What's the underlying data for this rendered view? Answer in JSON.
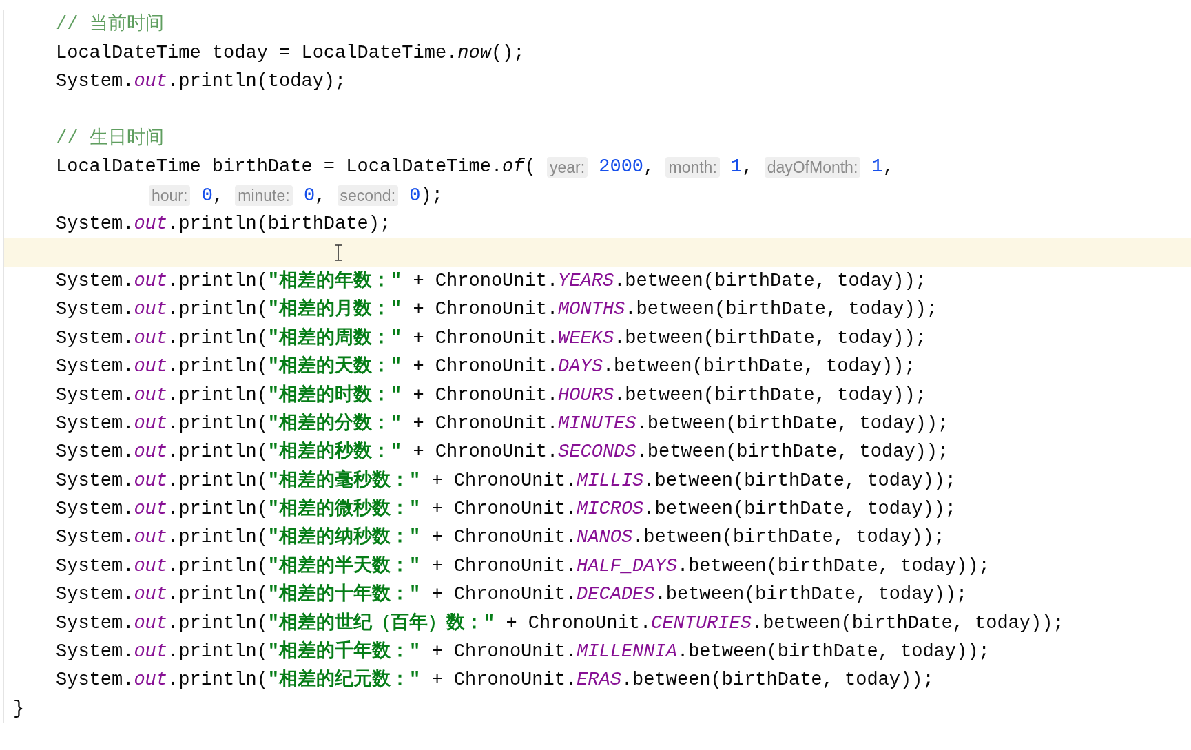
{
  "editor": {
    "lines": [
      {
        "kind": "code",
        "current": false,
        "tokens": [
          {
            "kind": "comment",
            "text": "// 当前时间"
          }
        ]
      },
      {
        "kind": "code",
        "current": false,
        "tokens": [
          {
            "kind": "plain",
            "text": "LocalDateTime today = LocalDateTime."
          },
          {
            "kind": "static_call",
            "text": "now"
          },
          {
            "kind": "plain",
            "text": "();"
          }
        ]
      },
      {
        "kind": "code",
        "current": false,
        "tokens": [
          {
            "kind": "plain",
            "text": "System."
          },
          {
            "kind": "field",
            "text": "out"
          },
          {
            "kind": "plain",
            "text": ".println(today);"
          }
        ]
      },
      {
        "kind": "blank",
        "current": false
      },
      {
        "kind": "code",
        "current": false,
        "tokens": [
          {
            "kind": "comment",
            "text": "// 生日时间"
          }
        ]
      },
      {
        "kind": "code",
        "current": false,
        "tokens": [
          {
            "kind": "plain",
            "text": "LocalDateTime birthDate = LocalDateTime."
          },
          {
            "kind": "static_call",
            "text": "of"
          },
          {
            "kind": "plain",
            "text": "( "
          },
          {
            "kind": "hint",
            "text": "year:"
          },
          {
            "kind": "number",
            "text": " 2000"
          },
          {
            "kind": "plain",
            "text": ", "
          },
          {
            "kind": "hint",
            "text": "month:"
          },
          {
            "kind": "number",
            "text": " 1"
          },
          {
            "kind": "plain",
            "text": ", "
          },
          {
            "kind": "hint",
            "text": "dayOfMonth:"
          },
          {
            "kind": "number",
            "text": " 1"
          },
          {
            "kind": "plain",
            "text": ","
          }
        ]
      },
      {
        "kind": "continuation",
        "current": false,
        "tokens": [
          {
            "kind": "hint",
            "text": "hour:"
          },
          {
            "kind": "number",
            "text": " 0"
          },
          {
            "kind": "plain",
            "text": ", "
          },
          {
            "kind": "hint",
            "text": "minute:"
          },
          {
            "kind": "number",
            "text": " 0"
          },
          {
            "kind": "plain",
            "text": ", "
          },
          {
            "kind": "hint",
            "text": "second:"
          },
          {
            "kind": "number",
            "text": " 0"
          },
          {
            "kind": "plain",
            "text": ");"
          }
        ]
      },
      {
        "kind": "code",
        "current": false,
        "tokens": [
          {
            "kind": "plain",
            "text": "System."
          },
          {
            "kind": "field",
            "text": "out"
          },
          {
            "kind": "plain",
            "text": ".println(birthDate);"
          }
        ]
      },
      {
        "kind": "blank",
        "current": true
      },
      {
        "kind": "code",
        "current": false,
        "tokens": [
          {
            "kind": "plain",
            "text": "System."
          },
          {
            "kind": "field",
            "text": "out"
          },
          {
            "kind": "plain",
            "text": ".println("
          },
          {
            "kind": "string",
            "text": "\"相差的年数：\""
          },
          {
            "kind": "plain",
            "text": " + ChronoUnit."
          },
          {
            "kind": "field",
            "text": "YEARS"
          },
          {
            "kind": "plain",
            "text": ".between(birthDate, today));"
          }
        ]
      },
      {
        "kind": "code",
        "current": false,
        "tokens": [
          {
            "kind": "plain",
            "text": "System."
          },
          {
            "kind": "field",
            "text": "out"
          },
          {
            "kind": "plain",
            "text": ".println("
          },
          {
            "kind": "string",
            "text": "\"相差的月数：\""
          },
          {
            "kind": "plain",
            "text": " + ChronoUnit."
          },
          {
            "kind": "field",
            "text": "MONTHS"
          },
          {
            "kind": "plain",
            "text": ".between(birthDate, today));"
          }
        ]
      },
      {
        "kind": "code",
        "current": false,
        "tokens": [
          {
            "kind": "plain",
            "text": "System."
          },
          {
            "kind": "field",
            "text": "out"
          },
          {
            "kind": "plain",
            "text": ".println("
          },
          {
            "kind": "string",
            "text": "\"相差的周数：\""
          },
          {
            "kind": "plain",
            "text": " + ChronoUnit."
          },
          {
            "kind": "field",
            "text": "WEEKS"
          },
          {
            "kind": "plain",
            "text": ".between(birthDate, today));"
          }
        ]
      },
      {
        "kind": "code",
        "current": false,
        "tokens": [
          {
            "kind": "plain",
            "text": "System."
          },
          {
            "kind": "field",
            "text": "out"
          },
          {
            "kind": "plain",
            "text": ".println("
          },
          {
            "kind": "string",
            "text": "\"相差的天数：\""
          },
          {
            "kind": "plain",
            "text": " + ChronoUnit."
          },
          {
            "kind": "field",
            "text": "DAYS"
          },
          {
            "kind": "plain",
            "text": ".between(birthDate, today));"
          }
        ]
      },
      {
        "kind": "code",
        "current": false,
        "tokens": [
          {
            "kind": "plain",
            "text": "System."
          },
          {
            "kind": "field",
            "text": "out"
          },
          {
            "kind": "plain",
            "text": ".println("
          },
          {
            "kind": "string",
            "text": "\"相差的时数：\""
          },
          {
            "kind": "plain",
            "text": " + ChronoUnit."
          },
          {
            "kind": "field",
            "text": "HOURS"
          },
          {
            "kind": "plain",
            "text": ".between(birthDate, today));"
          }
        ]
      },
      {
        "kind": "code",
        "current": false,
        "tokens": [
          {
            "kind": "plain",
            "text": "System."
          },
          {
            "kind": "field",
            "text": "out"
          },
          {
            "kind": "plain",
            "text": ".println("
          },
          {
            "kind": "string",
            "text": "\"相差的分数：\""
          },
          {
            "kind": "plain",
            "text": " + ChronoUnit."
          },
          {
            "kind": "field",
            "text": "MINUTES"
          },
          {
            "kind": "plain",
            "text": ".between(birthDate, today));"
          }
        ]
      },
      {
        "kind": "code",
        "current": false,
        "tokens": [
          {
            "kind": "plain",
            "text": "System."
          },
          {
            "kind": "field",
            "text": "out"
          },
          {
            "kind": "plain",
            "text": ".println("
          },
          {
            "kind": "string",
            "text": "\"相差的秒数：\""
          },
          {
            "kind": "plain",
            "text": " + ChronoUnit."
          },
          {
            "kind": "field",
            "text": "SECONDS"
          },
          {
            "kind": "plain",
            "text": ".between(birthDate, today));"
          }
        ]
      },
      {
        "kind": "code",
        "current": false,
        "tokens": [
          {
            "kind": "plain",
            "text": "System."
          },
          {
            "kind": "field",
            "text": "out"
          },
          {
            "kind": "plain",
            "text": ".println("
          },
          {
            "kind": "string",
            "text": "\"相差的毫秒数：\""
          },
          {
            "kind": "plain",
            "text": " + ChronoUnit."
          },
          {
            "kind": "field",
            "text": "MILLIS"
          },
          {
            "kind": "plain",
            "text": ".between(birthDate, today));"
          }
        ]
      },
      {
        "kind": "code",
        "current": false,
        "tokens": [
          {
            "kind": "plain",
            "text": "System."
          },
          {
            "kind": "field",
            "text": "out"
          },
          {
            "kind": "plain",
            "text": ".println("
          },
          {
            "kind": "string",
            "text": "\"相差的微秒数：\""
          },
          {
            "kind": "plain",
            "text": " + ChronoUnit."
          },
          {
            "kind": "field",
            "text": "MICROS"
          },
          {
            "kind": "plain",
            "text": ".between(birthDate, today));"
          }
        ]
      },
      {
        "kind": "code",
        "current": false,
        "tokens": [
          {
            "kind": "plain",
            "text": "System."
          },
          {
            "kind": "field",
            "text": "out"
          },
          {
            "kind": "plain",
            "text": ".println("
          },
          {
            "kind": "string",
            "text": "\"相差的纳秒数：\""
          },
          {
            "kind": "plain",
            "text": " + ChronoUnit."
          },
          {
            "kind": "field",
            "text": "NANOS"
          },
          {
            "kind": "plain",
            "text": ".between(birthDate, today));"
          }
        ]
      },
      {
        "kind": "code",
        "current": false,
        "tokens": [
          {
            "kind": "plain",
            "text": "System."
          },
          {
            "kind": "field",
            "text": "out"
          },
          {
            "kind": "plain",
            "text": ".println("
          },
          {
            "kind": "string",
            "text": "\"相差的半天数：\""
          },
          {
            "kind": "plain",
            "text": " + ChronoUnit."
          },
          {
            "kind": "field",
            "text": "HALF_DAYS"
          },
          {
            "kind": "plain",
            "text": ".between(birthDate, today));"
          }
        ]
      },
      {
        "kind": "code",
        "current": false,
        "tokens": [
          {
            "kind": "plain",
            "text": "System."
          },
          {
            "kind": "field",
            "text": "out"
          },
          {
            "kind": "plain",
            "text": ".println("
          },
          {
            "kind": "string",
            "text": "\"相差的十年数：\""
          },
          {
            "kind": "plain",
            "text": " + ChronoUnit."
          },
          {
            "kind": "field",
            "text": "DECADES"
          },
          {
            "kind": "plain",
            "text": ".between(birthDate, today));"
          }
        ]
      },
      {
        "kind": "code",
        "current": false,
        "tokens": [
          {
            "kind": "plain",
            "text": "System."
          },
          {
            "kind": "field",
            "text": "out"
          },
          {
            "kind": "plain",
            "text": ".println("
          },
          {
            "kind": "string",
            "text": "\"相差的世纪（百年）数：\""
          },
          {
            "kind": "plain",
            "text": " + ChronoUnit."
          },
          {
            "kind": "field",
            "text": "CENTURIES"
          },
          {
            "kind": "plain",
            "text": ".between(birthDate, today));"
          }
        ]
      },
      {
        "kind": "code",
        "current": false,
        "tokens": [
          {
            "kind": "plain",
            "text": "System."
          },
          {
            "kind": "field",
            "text": "out"
          },
          {
            "kind": "plain",
            "text": ".println("
          },
          {
            "kind": "string",
            "text": "\"相差的千年数：\""
          },
          {
            "kind": "plain",
            "text": " + ChronoUnit."
          },
          {
            "kind": "field",
            "text": "MILLENNIA"
          },
          {
            "kind": "plain",
            "text": ".between(birthDate, today));"
          }
        ]
      },
      {
        "kind": "code",
        "current": false,
        "tokens": [
          {
            "kind": "plain",
            "text": "System."
          },
          {
            "kind": "field",
            "text": "out"
          },
          {
            "kind": "plain",
            "text": ".println("
          },
          {
            "kind": "string",
            "text": "\"相差的纪元数：\""
          },
          {
            "kind": "plain",
            "text": " + ChronoUnit."
          },
          {
            "kind": "field",
            "text": "ERAS"
          },
          {
            "kind": "plain",
            "text": ".between(birthDate, today));"
          }
        ]
      },
      {
        "kind": "top",
        "current": false,
        "tokens": [
          {
            "kind": "plain",
            "text": "}"
          }
        ]
      }
    ]
  }
}
